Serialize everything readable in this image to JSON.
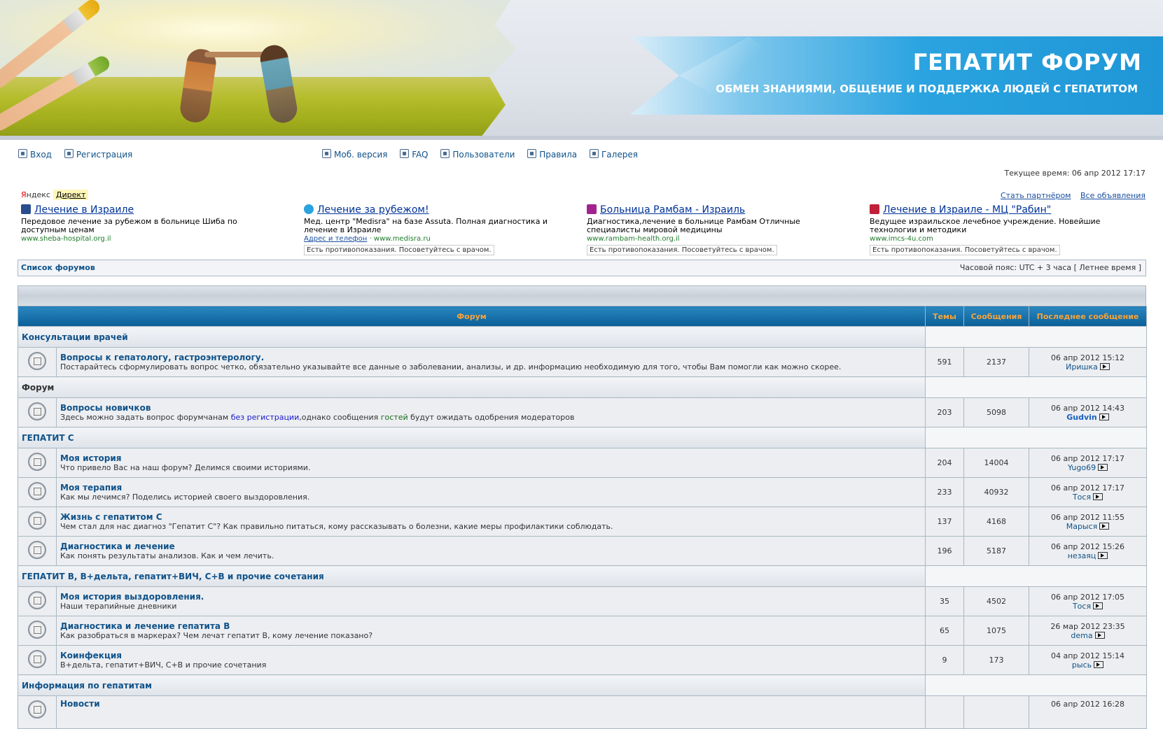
{
  "header": {
    "title": "ГЕПАТИТ ФОРУМ",
    "subtitle": "ОБМЕН ЗНАНИЯМИ, ОБЩЕНИЕ И ПОДДЕРЖКА ЛЮДЕЙ С ГЕПАТИТОМ"
  },
  "nav": {
    "login": "Вход",
    "register": "Регистрация",
    "mobile": "Моб. версия",
    "faq": "FAQ",
    "users": "Пользователи",
    "rules": "Правила",
    "gallery": "Галерея"
  },
  "current_time": "Текущее время: 06 апр 2012 17:17",
  "ads": {
    "yandex_prefix": "Я",
    "yandex_rest": "ндекс",
    "direct": "Директ",
    "become_partner": "Стать партнёром",
    "all_ads": "Все объявления",
    "warning": "Есть противопоказания. Посоветуйтесь с врачом.",
    "items": [
      {
        "title": "Лечение в Израиле",
        "desc": "Передовое лечение за рубежом в больнице Шиба по доступным ценам",
        "url": "www.sheba-hospital.org.il",
        "extra": ""
      },
      {
        "title": "Лечение за рубежом!",
        "desc": "Мед. центр \"Medisra\" на базе Assuta. Полная диагностика и лечение в Израиле",
        "url": "www.medisra.ru",
        "extra": "Адрес и телефон"
      },
      {
        "title": "Больница Рамбам - Израиль",
        "desc": "Диагностика,лечение в больнице Рамбам Отличные специалисты мировой медицины",
        "url": "www.rambam-health.org.il",
        "extra": ""
      },
      {
        "title": "Лечение в Израиле - МЦ \"Рабин\"",
        "desc": "Ведущее израильское лечебное учреждение. Новейшие технологии и методики",
        "url": "www.imcs-4u.com",
        "extra": ""
      }
    ]
  },
  "breadcrumb": {
    "forum_list": "Список форумов",
    "timezone": "Часовой пояс: UTC + 3 часа [ Летнее время ]"
  },
  "table": {
    "headers": {
      "forum": "Форум",
      "topics": "Темы",
      "posts": "Сообщения",
      "last": "Последнее сообщение"
    },
    "categories": [
      {
        "name": "Консультации врачей",
        "forums": [
          {
            "name": "Вопросы к гепатологу, гастроэнтерологу.",
            "desc": "Постарайтесь сформулировать вопрос четко, обязательно указывайте все данные о заболевании, анализы, и др. информацию необходимую для того, чтобы Вам помогли как можно скорее.",
            "topics": "591",
            "posts": "2137",
            "date": "06 апр 2012 15:12",
            "author": "Иришка"
          }
        ]
      },
      {
        "name": "Форум",
        "forums": [
          {
            "name": "Вопросы новичков",
            "desc_pre": "Здесь можно задать вопрос форумчанам ",
            "desc_link1": "без регистрации",
            "desc_mid": ",однако сообщения ",
            "desc_link2": "гостей",
            "desc_post": " будут ожидать одобрения модераторов",
            "topics": "203",
            "posts": "5098",
            "date": "06 апр 2012 14:43",
            "author": "Gudvin"
          }
        ]
      },
      {
        "name": "ГЕПАТИТ С",
        "forums": [
          {
            "name": "Моя история",
            "desc": "Что привело Вас на наш форум? Делимся своими историями.",
            "topics": "204",
            "posts": "14004",
            "date": "06 апр 2012 17:17",
            "author": "Yugo69"
          },
          {
            "name": "Моя терапия",
            "desc": "Как мы лечимся? Поделись историей своего выздоровления.",
            "topics": "233",
            "posts": "40932",
            "date": "06 апр 2012 17:17",
            "author": "Тося"
          },
          {
            "name": "Жизнь с гепатитом С",
            "desc": "Чем стал для нас диагноз \"Гепатит С\"? Как правильно питаться, кому рассказывать о болезни, какие меры профилактики соблюдать.",
            "topics": "137",
            "posts": "4168",
            "date": "06 апр 2012 11:55",
            "author": "Марыся"
          },
          {
            "name": "Диагностика и лечение",
            "desc": "Как понять результаты анализов. Как и чем лечить.",
            "topics": "196",
            "posts": "5187",
            "date": "06 апр 2012 15:26",
            "author": "незаяц"
          }
        ]
      },
      {
        "name": "ГЕПАТИТ В, В+дельта, гепатит+ВИЧ, С+В и прочие сочетания",
        "forums": [
          {
            "name": "Моя история выздоровления.",
            "desc": "Наши терапийные дневники",
            "topics": "35",
            "posts": "4502",
            "date": "06 апр 2012 17:05",
            "author": "Тося"
          },
          {
            "name": "Диагностика и лечение гепатита В",
            "desc": "Как разобраться в маркерах? Чем лечат гепатит В, кому лечение показано?",
            "topics": "65",
            "posts": "1075",
            "date": "26 мар 2012 23:35",
            "author": "dema"
          },
          {
            "name": "Коинфекция",
            "desc": "В+дельта, гепатит+ВИЧ, С+В и прочие сочетания",
            "topics": "9",
            "posts": "173",
            "date": "04 апр 2012 15:14",
            "author": "рысь"
          }
        ]
      },
      {
        "name": "Информация по гепатитам",
        "forums": [
          {
            "name": "Новости",
            "date": "06 апр 2012 16:28"
          }
        ]
      }
    ]
  }
}
